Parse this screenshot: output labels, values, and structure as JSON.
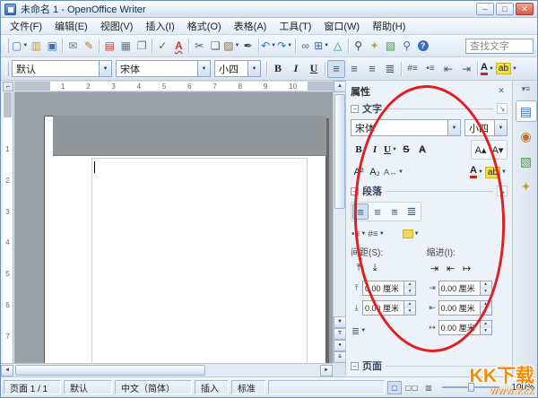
{
  "window": {
    "title": "未命名 1 - OpenOffice Writer"
  },
  "menu": {
    "items": [
      "文件(F)",
      "编辑(E)",
      "视图(V)",
      "插入(I)",
      "格式(O)",
      "表格(A)",
      "工具(T)",
      "窗口(W)",
      "帮助(H)"
    ]
  },
  "toolbar1": {
    "find_placeholder": "查找文字",
    "icons": [
      {
        "name": "new-document",
        "glyph": "▢",
        "color": "#3f6fb5",
        "dropdown": true
      },
      {
        "name": "open-document",
        "glyph": "▥",
        "color": "#c79a2e"
      },
      {
        "name": "save-document",
        "glyph": "▣",
        "color": "#3f6fb5"
      },
      {
        "sep": true
      },
      {
        "name": "document-as-email",
        "glyph": "✉",
        "color": "#6b7b8c"
      },
      {
        "name": "edit-file",
        "glyph": "✎",
        "color": "#b07a1e"
      },
      {
        "sep": true
      },
      {
        "name": "export-pdf",
        "glyph": "▤",
        "color": "#cc3a2f"
      },
      {
        "name": "print-file",
        "glyph": "▦",
        "color": "#667788"
      },
      {
        "name": "page-preview",
        "glyph": "❐",
        "color": "#667788"
      },
      {
        "sep": true
      },
      {
        "name": "spellcheck",
        "glyph": "✓",
        "color": "#2a8a2a"
      },
      {
        "name": "auto-spellcheck",
        "glyph": "A",
        "color": "#cc3a2f",
        "wavy": true
      },
      {
        "sep": true
      },
      {
        "name": "cut",
        "glyph": "✂",
        "color": "#556677"
      },
      {
        "name": "copy",
        "glyph": "❏",
        "color": "#556677"
      },
      {
        "name": "paste",
        "glyph": "▨",
        "color": "#8a6d3b",
        "dropdown": true
      },
      {
        "name": "format-paintbrush",
        "glyph": "✒",
        "color": "#334455"
      },
      {
        "sep": true
      },
      {
        "name": "undo",
        "glyph": "↶",
        "color": "#2a6fd4",
        "dropdown": true
      },
      {
        "name": "redo",
        "glyph": "↷",
        "color": "#2a6fd4",
        "dropdown": true
      },
      {
        "sep": true
      },
      {
        "name": "hyperlink",
        "glyph": "∞",
        "color": "#2a6fd4"
      },
      {
        "name": "insert-table",
        "glyph": "⊞",
        "color": "#3f6fb5",
        "dropdown": true
      },
      {
        "name": "draw-functions",
        "glyph": "△",
        "color": "#2a9a8a"
      },
      {
        "sep": true
      },
      {
        "name": "find-replace",
        "glyph": "⚲",
        "color": "#334455"
      },
      {
        "name": "navigator",
        "glyph": "✦",
        "color": "#c9a227"
      },
      {
        "name": "gallery",
        "glyph": "▧",
        "color": "#4a9a4a"
      },
      {
        "name": "zoom",
        "glyph": "⚲",
        "color": "#3f6fb5"
      },
      {
        "name": "help",
        "glyph": "?",
        "color": "#3f6fb5",
        "round": true
      }
    ]
  },
  "format_toolbar": {
    "style": "默认",
    "font": "宋体",
    "size": "小四",
    "labels": {
      "bold": "B",
      "italic": "I",
      "underline": "U"
    }
  },
  "ruler": {
    "h_numbers": [
      "1",
      "2",
      "3",
      "4",
      "5",
      "6",
      "7",
      "8",
      "9",
      "10"
    ],
    "v_numbers": [
      "1",
      "2",
      "3",
      "4",
      "5",
      "6",
      "7"
    ]
  },
  "sidebar": {
    "title": "属性",
    "tabs": [
      {
        "name": "properties",
        "glyph": "▤",
        "color": "#3a6fc4",
        "active": true
      },
      {
        "name": "styles-and-formatting",
        "glyph": "◉",
        "color": "#c46a2a",
        "active": false
      },
      {
        "name": "gallery",
        "glyph": "▧",
        "color": "#4a9a4a",
        "active": false
      },
      {
        "name": "navigator",
        "glyph": "✦",
        "color": "#c9a227",
        "active": false
      }
    ],
    "text_section": {
      "label": "文字",
      "font": "宋体",
      "size": "小四"
    },
    "paragraph_section": {
      "label": "段落",
      "spacing_label": "间距(S):",
      "indent_label": "缩进(I):",
      "spacing_spinners": [
        {
          "name": "above-paragraph-spacing",
          "glyph": "⤒",
          "value": "0.00 厘米"
        },
        {
          "name": "below-paragraph-spacing",
          "glyph": "⤓",
          "value": "0.00 厘米"
        }
      ],
      "indent_spinners": [
        {
          "name": "before-text-indent",
          "glyph": "⇥",
          "value": "0.00 厘米"
        },
        {
          "name": "after-text-indent",
          "glyph": "⇤",
          "value": "0.00 厘米"
        },
        {
          "name": "first-line-indent",
          "glyph": "↦",
          "value": "0.00 厘米"
        }
      ]
    },
    "page_section": {
      "label": "页面"
    }
  },
  "statusbar": {
    "page": "页面 1 / 1",
    "style": "默认",
    "language": "中文（简体）",
    "insert": "插入",
    "selection": "标准",
    "zoom": "100%"
  },
  "watermark": {
    "line1": "KK下载",
    "line2": "www.kkx",
    "color": "#ff8a00"
  },
  "annotation": {
    "shape": "ellipse",
    "color": "#e02020"
  }
}
